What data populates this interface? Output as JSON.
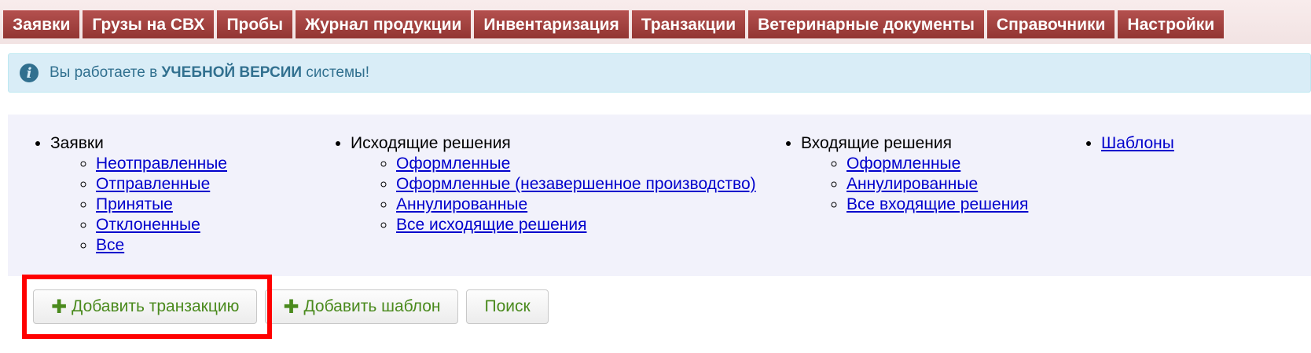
{
  "nav": {
    "items": [
      "Заявки",
      "Грузы на СВХ",
      "Пробы",
      "Журнал продукции",
      "Инвентаризация",
      "Транзакции",
      "Ветеринарные документы",
      "Справочники",
      "Настройки"
    ]
  },
  "alert": {
    "icon": "info-icon",
    "prefix": "Вы работаете в",
    "strong": "УЧЕБНОЙ ВЕРСИИ",
    "suffix": "системы!"
  },
  "menu": {
    "requests": {
      "title": "Заявки",
      "links": [
        "Неотправленные",
        "Отправленные",
        "Принятые",
        "Отклоненные",
        "Все"
      ]
    },
    "outgoing": {
      "title": "Исходящие решения",
      "links": [
        "Оформленные",
        "Оформленные (незавершенное производство)",
        "Аннулированные",
        "Все исходящие решения"
      ]
    },
    "incoming": {
      "title": "Входящие решения",
      "links": [
        "Оформленные",
        "Аннулированные",
        "Все входящие решения"
      ]
    },
    "templates": {
      "link": "Шаблоны"
    }
  },
  "buttons": {
    "add_transaction": "Добавить транзакцию",
    "add_template": "Добавить шаблон",
    "search": "Поиск",
    "plus_icon": "plus-icon"
  },
  "colors": {
    "nav_bg": "#a4413f",
    "alert_bg": "#d9edf7",
    "alert_text": "#31708f",
    "link": "#0000cc",
    "button_text": "#4a8a1d",
    "highlight": "#ff0000"
  }
}
